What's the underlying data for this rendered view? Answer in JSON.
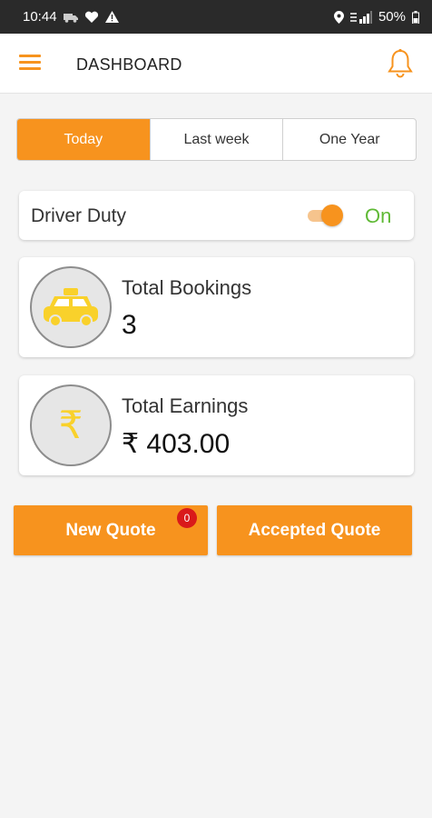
{
  "status_bar": {
    "time": "10:44",
    "battery": "50%",
    "left_icons": [
      "truck-icon",
      "heart-icon",
      "warning-icon"
    ],
    "right_icons": [
      "location-icon",
      "signal-icon",
      "battery-icon"
    ]
  },
  "header": {
    "title": "DASHBOARD",
    "menu_icon": "hamburger-menu-icon",
    "bell_icon": "bell-icon"
  },
  "period_tabs": [
    {
      "label": "Today",
      "active": true
    },
    {
      "label": "Last week",
      "active": false
    },
    {
      "label": "One Year",
      "active": false
    }
  ],
  "driver_duty": {
    "label": "Driver Duty",
    "state": "On",
    "enabled": true
  },
  "bookings": {
    "label": "Total Bookings",
    "value": "3",
    "icon": "taxi-icon"
  },
  "earnings": {
    "label": "Total Earnings",
    "value": "₹ 403.00",
    "icon": "rupee-icon",
    "icon_glyph": "₹"
  },
  "quotes": {
    "new_label": "New Quote",
    "new_count": "0",
    "accepted_label": "Accepted Quote"
  },
  "colors": {
    "accent": "#f7931e",
    "status_bar": "#2a2a2a",
    "on_green": "#5fb935",
    "badge_red": "#d9191a",
    "icon_yellow": "#f9d12b"
  }
}
